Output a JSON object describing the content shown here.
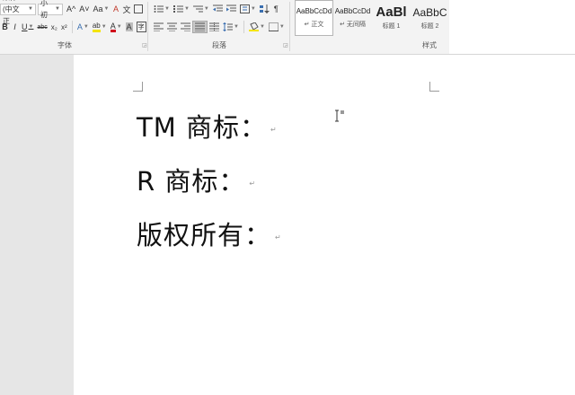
{
  "ribbon": {
    "font": {
      "font_name": "宋体 (中文正",
      "font_size": "小初",
      "grow_icon": "A^",
      "shrink_icon": "A˅",
      "case_label": "Aa",
      "clear_icon": "A",
      "wen_icon": "文",
      "bold": "B",
      "italic": "I",
      "underline": "U",
      "strike": "abc",
      "subscript": "x₂",
      "superscript": "x²",
      "effects": "A",
      "highlight": "ab",
      "color": "A",
      "char_shade": "A",
      "char_border": "字",
      "group_label": "字体"
    },
    "paragraph": {
      "group_label": "段落"
    },
    "styles": {
      "group_label": "样式",
      "items": [
        {
          "sample": "AaBbCcDd",
          "name": "↵ 正文"
        },
        {
          "sample": "AaBbCcDd",
          "name": "↵ 无间隔"
        },
        {
          "sample": "AaBl",
          "name": "标题 1"
        },
        {
          "sample": "AaBbC",
          "name": "标题 2"
        }
      ]
    }
  },
  "document": {
    "lines": [
      "TM 商标：",
      "R 商标：",
      "版权所有："
    ],
    "paragraph_mark": "↵"
  }
}
